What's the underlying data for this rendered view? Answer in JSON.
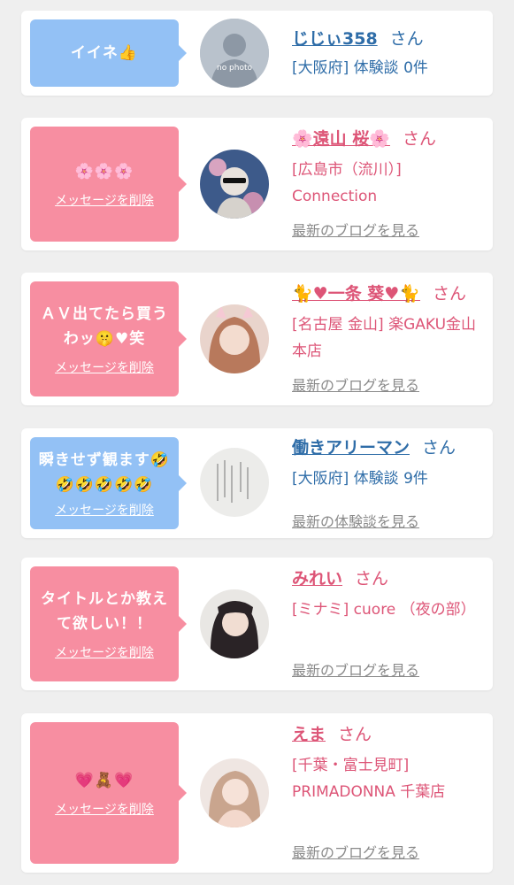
{
  "colors": {
    "pink_bubble": "#f78ea1",
    "blue_bubble": "#93c1f5",
    "pink_text": "#dd5577",
    "blue_text": "#2f6da8",
    "link_gray": "#8a8a8a"
  },
  "items": [
    {
      "message": "イイネ👍",
      "delete_label": "",
      "name": "じじぃ358",
      "honorific": "さん",
      "location": "[大阪府] 体験談 0件",
      "link": "",
      "avatar_text": "no photo"
    },
    {
      "message": "🌸🌸🌸",
      "delete_label": "メッセージを削除",
      "name": "🌸遠山 桜🌸",
      "honorific": "さん",
      "location": "[広島市（流川）] Connection",
      "link": "最新のブログを見る",
      "avatar_text": ""
    },
    {
      "message": "ＡＶ出てたら買うわッ🤫♥笑",
      "delete_label": "メッセージを削除",
      "name": "🐈♥一条 葵♥🐈",
      "honorific": "さん",
      "location": "[名古屋 金山] 楽GAKU金山本店",
      "link": "最新のブログを見る",
      "avatar_text": ""
    },
    {
      "message": "瞬きせず観ます🤣🤣🤣🤣🤣🤣",
      "delete_label": "メッセージを削除",
      "name": "働きアリーマン",
      "honorific": "さん",
      "location": "[大阪府] 体験談 9件",
      "link": "最新の体験談を見る",
      "avatar_text": ""
    },
    {
      "message": "タイトルとか教えて欲しい！！",
      "delete_label": "メッセージを削除",
      "name": "みれい",
      "honorific": "さん",
      "location": "[ミナミ] cuore （夜の部）",
      "link": "最新のブログを見る",
      "avatar_text": ""
    },
    {
      "message": "💗🧸💗",
      "delete_label": "メッセージを削除",
      "name": "えま",
      "honorific": "さん",
      "location": "[千葉・富士見町] PRIMADONNA 千葉店",
      "link": "最新のブログを見る",
      "avatar_text": ""
    }
  ]
}
